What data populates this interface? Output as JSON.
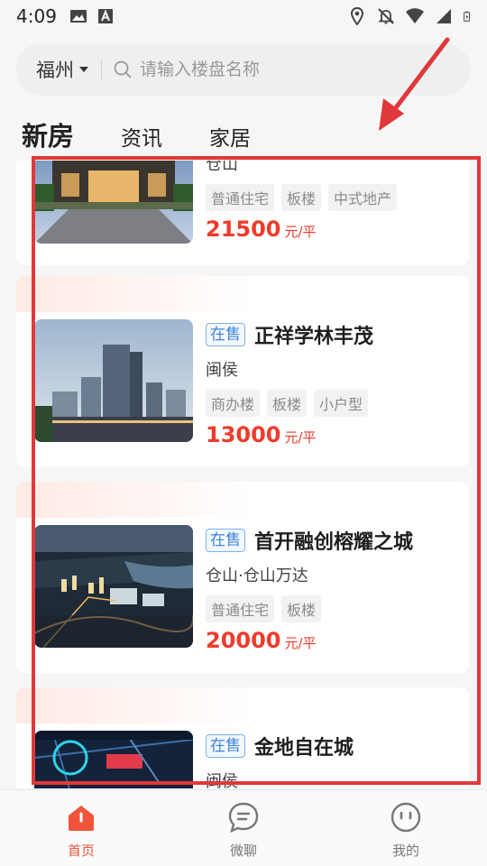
{
  "status_bar": {
    "time": "4:09",
    "left_icons": [
      "image-icon",
      "text-a-icon"
    ],
    "right_icons": [
      "location-icon",
      "bell-off-icon",
      "wifi-icon",
      "signal-icon",
      "battery-icon"
    ]
  },
  "search": {
    "city": "福州",
    "placeholder": "请输入楼盘名称"
  },
  "tabs": [
    {
      "label": "新房",
      "active": true
    },
    {
      "label": "资讯",
      "active": false
    },
    {
      "label": "家居",
      "active": false
    }
  ],
  "listings": [
    {
      "badge": "",
      "name": "",
      "district": "仓山",
      "tags": [
        "普通住宅",
        "板楼",
        "中式地产"
      ],
      "price": "21500",
      "unit": "元/平"
    },
    {
      "badge": "在售",
      "name": "正祥学林丰茂",
      "district": "闽侯",
      "tags": [
        "商办楼",
        "板楼",
        "小户型"
      ],
      "price": "13000",
      "unit": "元/平"
    },
    {
      "badge": "在售",
      "name": "首开融创榕耀之城",
      "district": "仓山·仓山万达",
      "tags": [
        "普通住宅",
        "板楼"
      ],
      "price": "20000",
      "unit": "元/平"
    },
    {
      "badge": "在售",
      "name": "金地自在城",
      "district": "闽侯",
      "tags": [],
      "price": "",
      "unit": ""
    }
  ],
  "bottom_nav": [
    {
      "label": "首页",
      "icon": "home-icon",
      "active": true
    },
    {
      "label": "微聊",
      "icon": "chat-icon",
      "active": false
    },
    {
      "label": "我的",
      "icon": "profile-icon",
      "active": false
    }
  ],
  "colors": {
    "accent": "#f0553b",
    "price": "#ee3b2b",
    "badge": "#3f83d8",
    "annotation": "#e0383a"
  }
}
